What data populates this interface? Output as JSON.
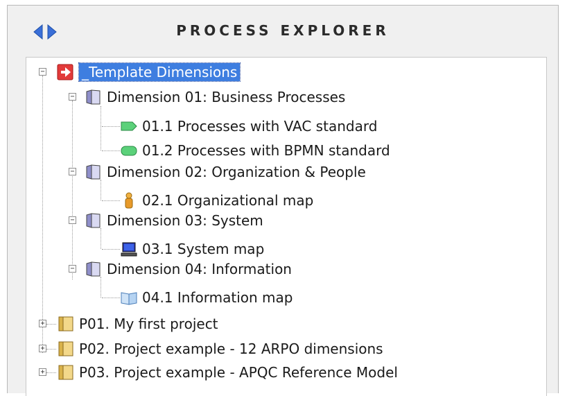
{
  "header": {
    "title": "PROCESS EXPLORER",
    "nav_left_icon": "arrow-left-icon",
    "nav_right_icon": "arrow-right-icon",
    "accent": "#3a6fd8"
  },
  "tree": {
    "root": {
      "label": "_Template Dimensions",
      "icon": "red-arrow-icon",
      "expanded": true,
      "selected": true
    },
    "dimensions": [
      {
        "label": "Dimension 01: Business Processes",
        "icon": "folder-icon",
        "children": [
          {
            "label": "01.1 Processes with VAC standard",
            "icon": "vac-shape-icon"
          },
          {
            "label": "01.2 Processes with BPMN standard",
            "icon": "bpmn-shape-icon"
          }
        ]
      },
      {
        "label": "Dimension 02: Organization & People",
        "icon": "folder-icon",
        "children": [
          {
            "label": "02.1 Organizational map",
            "icon": "person-icon"
          }
        ]
      },
      {
        "label": "Dimension 03: System",
        "icon": "folder-icon",
        "children": [
          {
            "label": "03.1 System map",
            "icon": "computer-icon"
          }
        ]
      },
      {
        "label": "Dimension 04: Information",
        "icon": "folder-icon",
        "children": [
          {
            "label": "04.1 Information map",
            "icon": "book-icon"
          }
        ]
      }
    ],
    "projects": [
      {
        "label": "P01. My first project",
        "icon": "project-folder-icon"
      },
      {
        "label": "P02. Project example - 12 ARPO dimensions",
        "icon": "project-folder-icon"
      },
      {
        "label": "P03. Project example - APQC Reference Model",
        "icon": "project-folder-icon"
      }
    ]
  }
}
